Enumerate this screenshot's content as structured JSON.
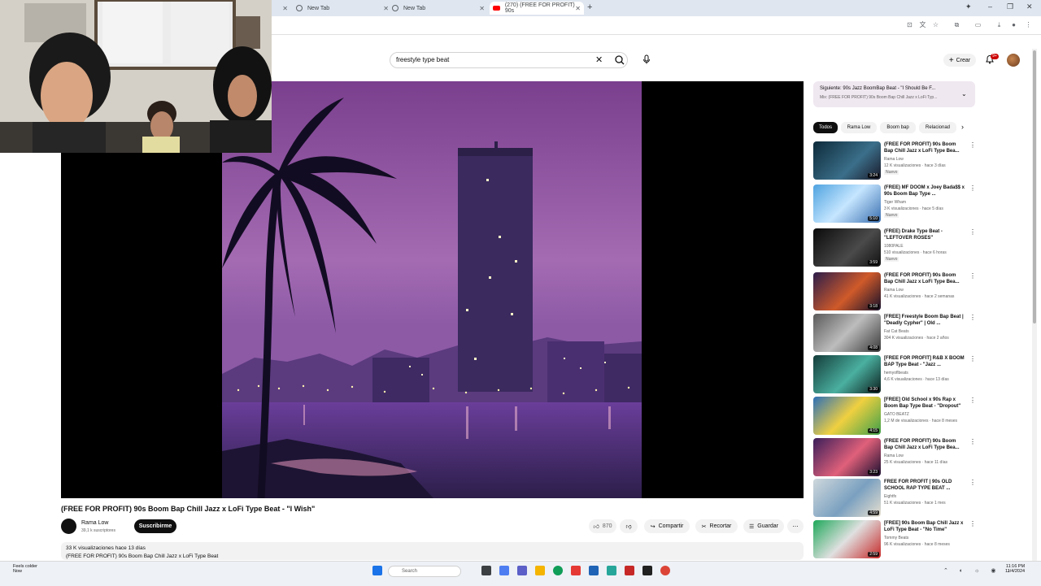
{
  "browser": {
    "tabs": [
      {
        "label": "New Tab",
        "active": false
      },
      {
        "label": "New Tab",
        "active": false
      },
      {
        "label": "New Tab",
        "active": false
      },
      {
        "label": "(270) (FREE FOR PROFIT) 90s",
        "active": true
      }
    ],
    "new_tab_symbol": "+",
    "window_controls": [
      "–",
      "❐",
      "✕"
    ]
  },
  "youtube": {
    "search_query": "freestyle type beat",
    "create_label": "Crear",
    "notifications_badge": "9+"
  },
  "video": {
    "title": "(FREE FOR PROFIT) 90s Boom Bap Chill Jazz x LoFi Type Beat - \"I Wish\"",
    "channel": "Rama Low",
    "subscribers": "39,1 k suscriptores",
    "subscribe_label": "Suscribirme",
    "like_count": "870",
    "share_label": "Compartir",
    "clip_label": "Recortar",
    "save_label": "Guardar",
    "more_label": "⋯",
    "desc_stats": "33 K visualizaciones  hace 13 días",
    "desc_line": "(FREE FOR PROFIT) 90s Boom Bap Chill Jazz x LoFi Type Beat"
  },
  "sidebar": {
    "mix_next": "Siguiente: 90s Jazz BoomBap Beat - \"I Should Be F...",
    "mix_sub": "Mix: (FREE FOR PROFIT) 90s Boom Bap Chill Jazz x LoFi Typ...",
    "chips": [
      "Todos",
      "Rama Low",
      "Boom bap",
      "Relacionad"
    ],
    "recommendations": [
      {
        "title": "(FREE FOR PROFIT) 90s Boom Bap Chill Jazz x LoFi Type Bea...",
        "channel": "Rama Low",
        "meta": "12 K visualizaciones · hace 3 días",
        "badge": "Nuevo",
        "duration": "3:24"
      },
      {
        "title": "(FREE) MF DOOM x Joey Bada$$ x 90s Boom Bap Type ...",
        "channel": "Tiger Wham",
        "meta": "3 K visualizaciones · hace 5 días",
        "badge": "Nuevo",
        "duration": "5:10"
      },
      {
        "title": "(FREE) Drake Type Beat - \"LEFTOVER ROSES\"",
        "channel": "1080PALE",
        "meta": "510 visualizaciones · hace 6 horas",
        "badge": "Nuevo",
        "duration": "3:59"
      },
      {
        "title": "(FREE FOR PROFIT) 90s Boom Bap Chill Jazz x LoFi Type Bea...",
        "channel": "Rama Low",
        "meta": "41 K visualizaciones · hace 2 semanas",
        "badge": "",
        "duration": "3:18"
      },
      {
        "title": "[FREE] Freestyle Boom Bap Beat | \"Deadly Cypher\" | Old ...",
        "channel": "Fat Cat Beats",
        "meta": "304 K visualizaciones · hace 2 años",
        "badge": "",
        "duration": "4:08"
      },
      {
        "title": "[FREE FOR PROFIT] R&B X BOOM BAP Type Beat - \"Jazz ...",
        "channel": "hemyoflbeats",
        "meta": "4,6 K visualizaciones · hace 13 días",
        "badge": "",
        "duration": "3:30"
      },
      {
        "title": "[FREE] Old School x 90s Rap x Boom Bap Type Beat - \"Dropout\"",
        "channel": "GATO BEATZ",
        "meta": "1,2 M de visualizaciones · hace 8 meses",
        "badge": "",
        "duration": "4:15"
      },
      {
        "title": "(FREE FOR PROFIT) 90s Boom Bap Chill Jazz x LoFi Type Bea...",
        "channel": "Rama Low",
        "meta": "25 K visualizaciones · hace 11 días",
        "badge": "",
        "duration": "3:23"
      },
      {
        "title": "FREE FOR PROFIT | 90s OLD SCHOOL RAP TYPE BEAT ...",
        "channel": "Eightfx",
        "meta": "51 K visualizaciones · hace 1 mes",
        "badge": "",
        "duration": "4:59"
      },
      {
        "title": "[FREE] 90s Boom Bap Chill Jazz x LoFi Type Beat - \"No Time\"",
        "channel": "Tommy Beats",
        "meta": "96 K visualizaciones · hace 8 meses",
        "badge": "",
        "duration": "2:59"
      }
    ]
  },
  "taskbar": {
    "weather_line1": "Feels colder",
    "weather_line2": "Now",
    "search_placeholder": "Search",
    "time": "11:16 PM",
    "date": "11/4/2024"
  }
}
